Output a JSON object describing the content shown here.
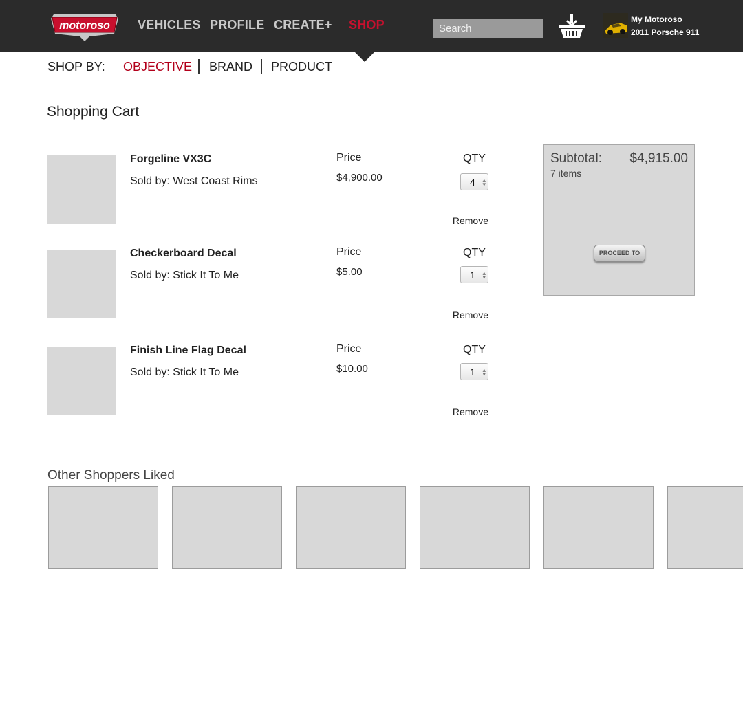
{
  "header": {
    "logo_text": "motoroso",
    "nav": [
      {
        "label": "VEHICLES",
        "active": false
      },
      {
        "label": "PROFILE",
        "active": false
      },
      {
        "label": "CREATE+",
        "active": false
      },
      {
        "label": "SHOP",
        "active": true
      }
    ],
    "search_placeholder": "Search",
    "basket_icon": "shopping-basket-icon",
    "profile": {
      "name": "My Motoroso",
      "vehicle": "2011 Porsche 911"
    }
  },
  "shop_by": {
    "label": "SHOP BY:",
    "links": [
      {
        "label": "OBJECTIVE",
        "active": true
      },
      {
        "label": "BRAND",
        "active": false
      },
      {
        "label": "PRODUCT",
        "active": false
      }
    ]
  },
  "cart": {
    "title": "Shopping Cart",
    "price_header": "Price",
    "qty_header": "QTY",
    "remove_label": "Remove",
    "items": [
      {
        "name": "Forgeline VX3C",
        "seller": "Sold by: West Coast Rims",
        "price": "$4,900.00",
        "qty": "4"
      },
      {
        "name": "Checkerboard Decal",
        "seller": "Sold by: Stick It To Me",
        "price": "$5.00",
        "qty": "1"
      },
      {
        "name": "Finish Line Flag Decal",
        "seller": "Sold by: Stick It To Me",
        "price": "$10.00",
        "qty": "1"
      }
    ]
  },
  "summary": {
    "subtotal_label": "Subtotal:",
    "subtotal_value": "$4,915.00",
    "items_count": "7 items",
    "proceed_label": "PROCEED TO"
  },
  "recommendations": {
    "title": "Other Shoppers Liked",
    "tile_count": 6
  },
  "colors": {
    "header_bg": "#2b2b2b",
    "accent_red": "#c8102e",
    "placeholder_gray": "#d8d8d8"
  }
}
